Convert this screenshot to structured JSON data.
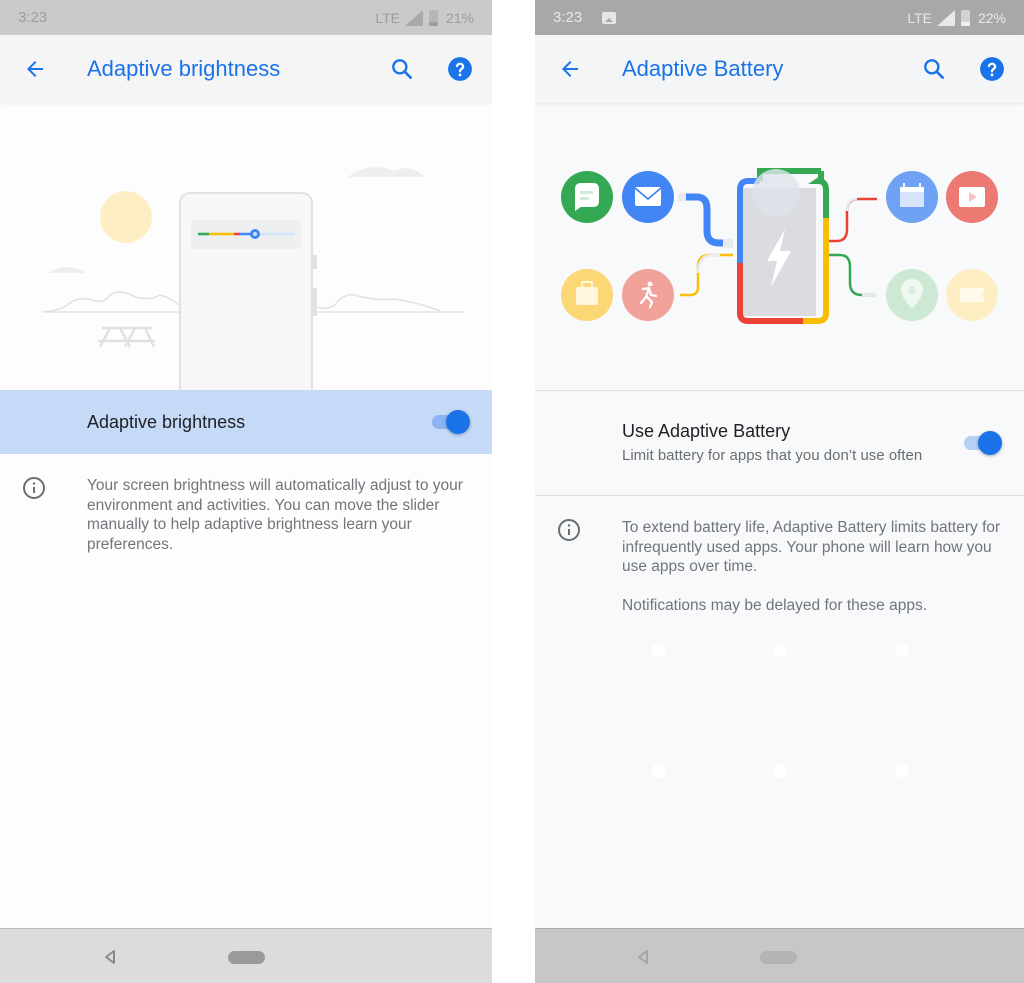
{
  "left": {
    "status": {
      "time": "3:23",
      "network": "LTE",
      "battery": "21%"
    },
    "app_bar": {
      "title": "Adaptive brightness",
      "back_icon": "arrow-back-icon",
      "search_icon": "search-icon",
      "help_icon": "help-icon"
    },
    "toggle": {
      "title": "Adaptive brightness",
      "enabled": true
    },
    "info": {
      "paragraphs": [
        "Your screen brightness will automatically adjust to your environment and activities. You can move the slider manually to help adaptive brightness learn your preferences."
      ]
    },
    "illustration": {
      "slider_level": 0.58,
      "colors": {
        "green": "#34a853",
        "yellow": "#fbbc04",
        "red": "#ea4335",
        "blue": "#4285f4",
        "sun": "#fdefc3"
      }
    }
  },
  "right": {
    "status": {
      "time": "3:23",
      "network": "LTE",
      "battery": "22%",
      "notification_icon": "image-icon"
    },
    "app_bar": {
      "title": "Adaptive Battery",
      "back_icon": "arrow-back-icon",
      "search_icon": "search-icon",
      "help_icon": "help-icon"
    },
    "toggle": {
      "title": "Use Adaptive Battery",
      "subtitle": "Limit battery for apps that you don’t use often",
      "enabled": true
    },
    "info": {
      "paragraphs": [
        "To extend battery life, Adaptive Battery limits battery for infrequently used apps. Your phone will learn how you use apps over time.",
        "Notifications may be delayed for these apps."
      ]
    },
    "illustration": {
      "apps_left": [
        {
          "name": "messages",
          "color": "#34a853"
        },
        {
          "name": "email",
          "color": "#4285f4"
        },
        {
          "name": "briefcase",
          "color": "#fbd775"
        },
        {
          "name": "fitness",
          "color": "#f1a29b"
        }
      ],
      "apps_right": [
        {
          "name": "calendar",
          "color": "#6fa2f4"
        },
        {
          "name": "video",
          "color": "#ec7a72"
        },
        {
          "name": "maps",
          "color": "#cde8d3"
        },
        {
          "name": "tickets",
          "color": "#fdefc3"
        }
      ]
    }
  },
  "brand": {
    "accent": "#1a73e8",
    "highlight_row": "#c5daf7"
  }
}
